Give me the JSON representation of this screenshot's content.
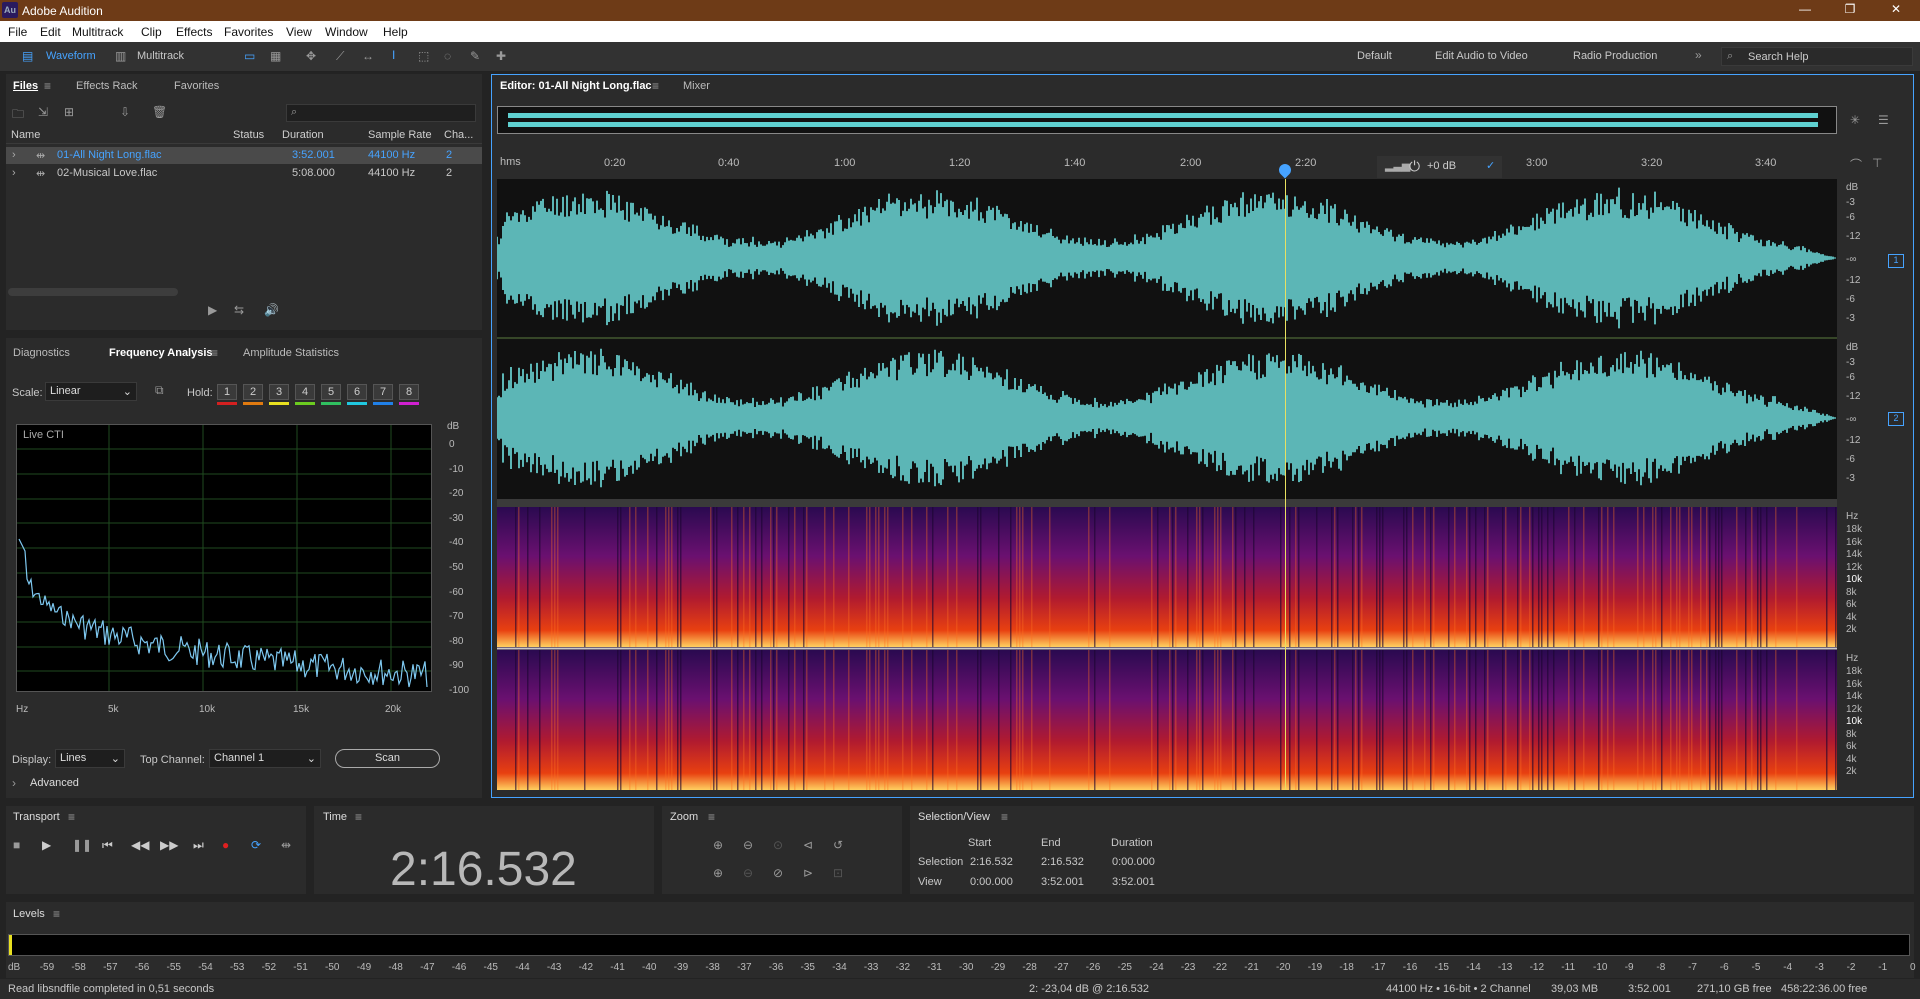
{
  "app": {
    "title": "Adobe Audition",
    "logo": "Au"
  },
  "menu": [
    "File",
    "Edit",
    "Multitrack",
    "Clip",
    "Effects",
    "Favorites",
    "View",
    "Window",
    "Help"
  ],
  "toolbar": {
    "waveform": "Waveform",
    "multitrack": "Multitrack",
    "workspaces": [
      "Default",
      "Edit Audio to Video",
      "Radio Production"
    ],
    "search_placeholder": "Search Help"
  },
  "files_panel": {
    "tabs": [
      "Files",
      "Effects Rack",
      "Favorites"
    ],
    "columns": [
      "Name",
      "Status",
      "Duration",
      "Sample Rate",
      "Cha..."
    ],
    "rows": [
      {
        "name": "01-All Night Long.flac",
        "status": "",
        "duration": "3:52.001",
        "rate": "44100 Hz",
        "ch": "2",
        "selected": true
      },
      {
        "name": "02-Musical Love.flac",
        "status": "",
        "duration": "5:08.000",
        "rate": "44100 Hz",
        "ch": "2",
        "selected": false
      }
    ]
  },
  "analysis_panel": {
    "tabs": [
      "Diagnostics",
      "Frequency Analysis",
      "Amplitude Statistics"
    ],
    "scale_label": "Scale:",
    "scale_value": "Linear",
    "hold_label": "Hold:",
    "holds": [
      "1",
      "2",
      "3",
      "4",
      "5",
      "6",
      "7",
      "8"
    ],
    "hold_colors": [
      "#d42020",
      "#e07a10",
      "#e8e020",
      "#6ccc20",
      "#30c060",
      "#20c8e0",
      "#2080e8",
      "#d020d0"
    ],
    "live_cti": "Live CTI",
    "db_unit": "dB",
    "db_ticks": [
      "0",
      "-10",
      "-20",
      "-30",
      "-40",
      "-50",
      "-60",
      "-70",
      "-80",
      "-90",
      "-100"
    ],
    "freq_ticks": [
      "Hz",
      "5k",
      "10k",
      "15k",
      "20k"
    ],
    "display_label": "Display:",
    "display_value": "Lines",
    "top_channel_label": "Top Channel:",
    "top_channel_value": "Channel 1",
    "scan_button": "Scan",
    "advanced": "Advanced"
  },
  "editor": {
    "tabs": [
      "Editor: 01-All Night Long.flac",
      "Mixer"
    ],
    "ruler_unit": "hms",
    "ruler_ticks": [
      "0:20",
      "0:40",
      "1:00",
      "1:20",
      "1:40",
      "2:00",
      "2:20",
      "3:00",
      "3:20",
      "3:40"
    ],
    "gain": "+0 dB",
    "db_scale_top": [
      "dB",
      "-3",
      "-6",
      "-12",
      "-∞",
      "-12",
      "-6",
      "-3"
    ],
    "channel_labels": [
      "1",
      "2"
    ],
    "hz_scale": [
      "Hz",
      "18k",
      "16k",
      "14k",
      "12k",
      "10k",
      "8k",
      "6k",
      "4k",
      "2k"
    ]
  },
  "transport": {
    "title": "Transport"
  },
  "time": {
    "title": "Time",
    "value": "2:16.532"
  },
  "zoom": {
    "title": "Zoom"
  },
  "selection_view": {
    "title": "Selection/View",
    "cols": [
      "Start",
      "End",
      "Duration"
    ],
    "rows": [
      {
        "label": "Selection",
        "start": "2:16.532",
        "end": "2:16.532",
        "duration": "0:00.000"
      },
      {
        "label": "View",
        "start": "0:00.000",
        "end": "3:52.001",
        "duration": "3:52.001"
      }
    ]
  },
  "levels": {
    "title": "Levels",
    "ticks": [
      "dB",
      "-59",
      "-58",
      "-57",
      "-56",
      "-55",
      "-54",
      "-53",
      "-52",
      "-51",
      "-50",
      "-49",
      "-48",
      "-47",
      "-46",
      "-45",
      "-44",
      "-43",
      "-42",
      "-41",
      "-40",
      "-39",
      "-38",
      "-37",
      "-36",
      "-35",
      "-34",
      "-33",
      "-32",
      "-31",
      "-30",
      "-29",
      "-28",
      "-27",
      "-26",
      "-25",
      "-24",
      "-23",
      "-22",
      "-21",
      "-20",
      "-19",
      "-18",
      "-17",
      "-16",
      "-15",
      "-14",
      "-13",
      "-12",
      "-11",
      "-10",
      "-9",
      "-8",
      "-7",
      "-6",
      "-5",
      "-4",
      "-3",
      "-2",
      "-1",
      "0"
    ]
  },
  "status": {
    "left": "Read libsndfile completed in 0,51 seconds",
    "mid": "2: -23,04 dB @ 2:16.532",
    "format": "44100 Hz • 16-bit • 2 Channel",
    "size": "39,03 MB",
    "dur": "3:52.001",
    "free": "271,10 GB free",
    "free_time": "458:22:36.00 free"
  },
  "colors": {
    "accent": "#46a3ff",
    "waveform": "#6fe0e0",
    "playhead": "#e8e060"
  }
}
